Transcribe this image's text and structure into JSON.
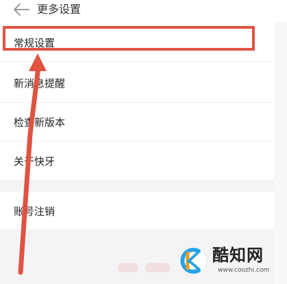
{
  "header": {
    "back_icon": "back-arrow-icon",
    "title": "更多设置"
  },
  "settings": {
    "items": [
      {
        "label": "常规设置"
      },
      {
        "label": "新消息提醒"
      },
      {
        "label": "检查新版本"
      },
      {
        "label": "关于快牙"
      },
      {
        "label": "账号注销"
      }
    ]
  },
  "annotation": {
    "color": "#e05343"
  },
  "watermark": {
    "name": "酷知网",
    "url": "www.coozhi.com",
    "logo_icon": "coozhi-logo-icon"
  }
}
